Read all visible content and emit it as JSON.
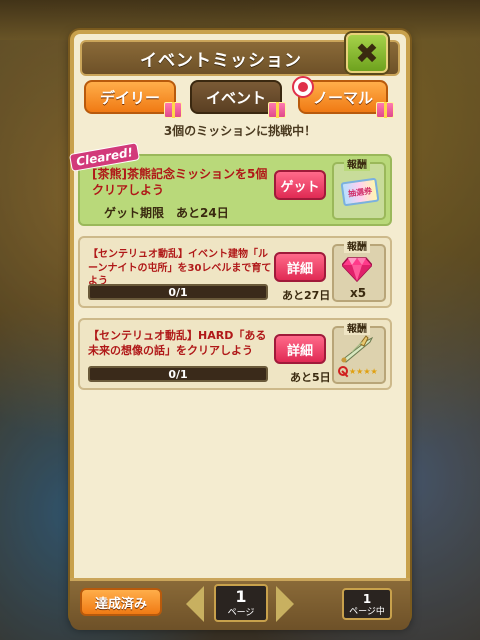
{
  "panel": {
    "title": "イベントミッション",
    "close_label": "✖"
  },
  "tabs": [
    {
      "label": "デイリー",
      "active": false
    },
    {
      "label": "イベント",
      "active": true
    },
    {
      "label": "ノーマル",
      "active": false
    }
  ],
  "challenge_text": "3個のミッションに挑戦中！",
  "missions": [
    {
      "status_tag": "Cleared!",
      "text": "[茶熊]茶熊記念ミッションを5個クリアしよう",
      "deadline": "ゲット期限　あと24日",
      "button_label": "ゲット",
      "reward_label": "報酬",
      "reward_text": "抽選券"
    },
    {
      "text": "【センテリュオ動乱】イベント建物「ルーンナイトの屯所」を30レベルまで育てよう",
      "progress": "0/1",
      "progress_fraction": 0,
      "remaining": "あと27日",
      "button_label": "詳細",
      "reward_label": "報酬",
      "reward_count": "x5",
      "reward_icon": "gem-icon"
    },
    {
      "text": "【センテリュオ動乱】HARD「ある未来の想像の話」をクリアしよう",
      "progress": "0/1",
      "progress_fraction": 0,
      "remaining": "あと5日",
      "button_label": "詳細",
      "reward_label": "報酬",
      "reward_stars": "★★★★",
      "reward_icon": "sword-icon"
    }
  ],
  "bottom": {
    "done_label": "達成済み",
    "current_page": "1",
    "page_unit": "ページ",
    "total_pages": "1",
    "total_unit": "ページ中"
  }
}
